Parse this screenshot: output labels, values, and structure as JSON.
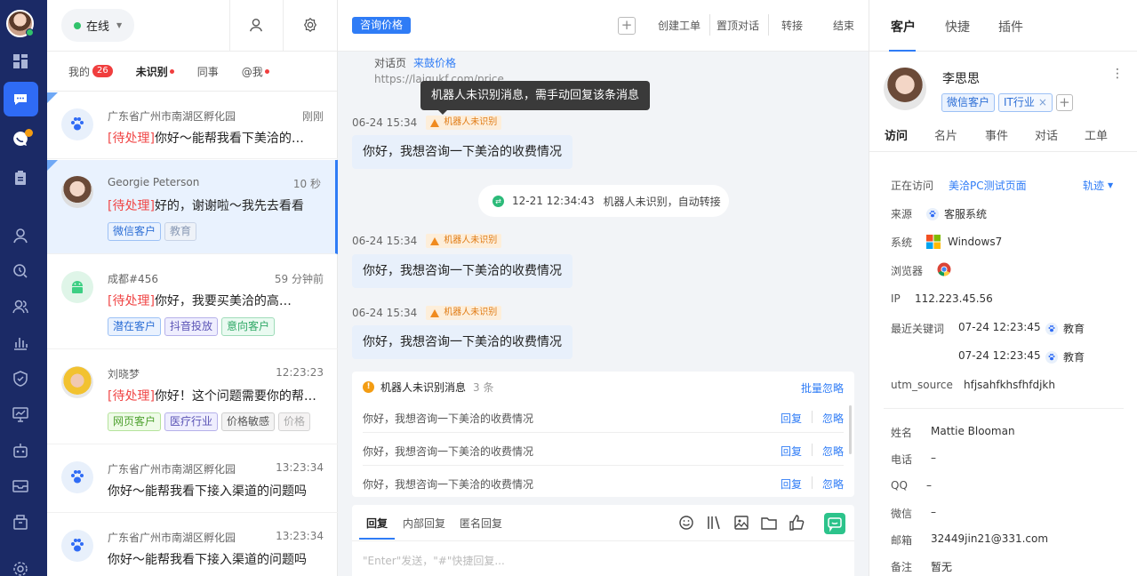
{
  "sidebar": {
    "icons": [
      "dashboard-icon",
      "chat-icon",
      "message-icon",
      "clipboard-icon",
      "user-icon",
      "search-clock-icon",
      "team-icon",
      "bar-chart-icon",
      "shield-icon",
      "monitor-icon",
      "robot-icon",
      "mail-icon",
      "package-icon",
      "settings-icon"
    ]
  },
  "list": {
    "status": "在线",
    "tabs": [
      {
        "label": "我的",
        "count": "26"
      },
      {
        "label": "未识别"
      },
      {
        "label": "同事"
      },
      {
        "label": "@我"
      }
    ],
    "items": [
      {
        "name": "广东省广州市南湖区孵化园",
        "time": "刚刚",
        "pending": "[待处理]",
        "msg": "你好～能帮我看下美洽的…",
        "tags": []
      },
      {
        "name": "Georgie Peterson",
        "time": "10 秒",
        "pending": "[待处理]",
        "msg": "好的，谢谢啦～我先去看看",
        "tags": [
          "微信客户",
          "教育"
        ]
      },
      {
        "name": "成都#456",
        "time": "59 分钟前",
        "pending": "[待处理]",
        "msg": "你好，我要买美洽的高…",
        "tags": [
          "潜在客户",
          "抖音投放",
          "意向客户"
        ]
      },
      {
        "name": "刘晓梦",
        "time": "12:23:23",
        "pending": "[待处理]",
        "msg": "你好！这个问题需要你的帮…",
        "tags": [
          "网页客户",
          "医疗行业",
          "价格敏感",
          "价格"
        ]
      },
      {
        "name": "广东省广州市南湖区孵化园",
        "time": "13:23:34",
        "pending": "",
        "msg": "你好～能帮我看下接入渠道的问题吗",
        "tags": []
      },
      {
        "name": "广东省广州市南湖区孵化园",
        "time": "13:23:34",
        "pending": "",
        "msg": "你好～能帮我看下接入渠道的问题吗",
        "tags": []
      }
    ]
  },
  "chat": {
    "consult_tag": "咨询价格",
    "actions": [
      "创建工单",
      "置顶对话",
      "转接",
      "结束"
    ],
    "system": {
      "label": "对话页",
      "link_text": "来鼓价格",
      "url": "https://lajqukf.com/price"
    },
    "tooltip": "机器人未识别消息，需手动回复该条消息",
    "messages": [
      {
        "time": "06-24 15:34",
        "warn": "机器人未识别",
        "text": "你好，我想咨询一下美洽的收费情况"
      },
      {
        "time": "06-24 15:34",
        "warn": "机器人未识别",
        "text": "你好，我想咨询一下美洽的收费情况"
      },
      {
        "time": "06-24 15:34",
        "warn": "机器人未识别",
        "text": "你好，我想咨询一下美洽的收费情况"
      }
    ],
    "system_note": {
      "time": "12-21 12:34:43",
      "text": "机器人未识别，自动转接"
    },
    "unrecognized": {
      "title": "机器人未识别消息",
      "count": "3 条",
      "batch_ignore": "批量忽略",
      "rows": [
        {
          "text": "你好，我想咨询一下美洽的收费情况",
          "reply": "回复",
          "ignore": "忽略"
        },
        {
          "text": "你好，我想咨询一下美洽的收费情况",
          "reply": "回复",
          "ignore": "忽略"
        },
        {
          "text": "你好，我想咨询一下美洽的收费情况",
          "reply": "回复",
          "ignore": "忽略"
        }
      ]
    },
    "reply_tabs": [
      "回复",
      "内部回复",
      "匿名回复"
    ],
    "placeholder": "\"Enter\"发送，\"#\"快捷回复..."
  },
  "right": {
    "tabs": [
      "客户",
      "快捷",
      "插件"
    ],
    "profile": {
      "name": "李思思",
      "tags": [
        "微信客户",
        "IT行业"
      ]
    },
    "subtabs": [
      "访问",
      "名片",
      "事件",
      "对话",
      "工单"
    ],
    "visit": {
      "visiting_label": "正在访问",
      "visiting_value": "美洽PC测试页面",
      "track": "轨迹",
      "source_label": "来源",
      "source_value": "客服系统",
      "os_label": "系统",
      "os_value": "Windows7",
      "browser_label": "浏览器",
      "ip_label": "IP",
      "ip_value": "112.223.45.56",
      "keyword_label": "最近关键词",
      "keywords": [
        {
          "time": "07-24 12:23:45",
          "word": "教育"
        },
        {
          "time": "07-24 12:23:45",
          "word": "教育"
        }
      ],
      "utm_label": "utm_source",
      "utm_value": "hfjsahfkhsfhfdjkh"
    },
    "card": {
      "name_label": "姓名",
      "name_value": "Mattie Blooman",
      "phone_label": "电话",
      "phone_value": "–",
      "qq_label": "QQ",
      "qq_value": "–",
      "wechat_label": "微信",
      "wechat_value": "–",
      "email_label": "邮箱",
      "email_value": "32449jin21@331.com",
      "note_label": "备注",
      "note_value": "暂无"
    }
  }
}
